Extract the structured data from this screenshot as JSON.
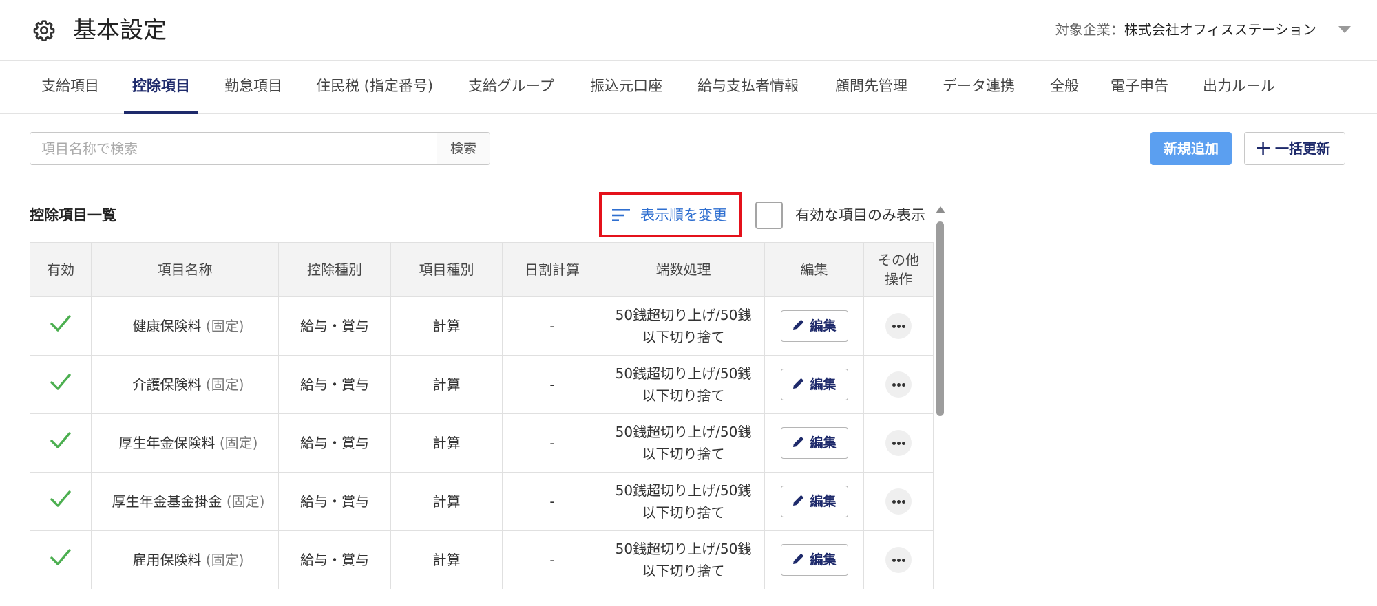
{
  "header": {
    "title": "基本設定",
    "company_label": "対象企業：",
    "company_name": "株式会社オフィスステーション"
  },
  "tabs": [
    {
      "label": "支給項目",
      "active": false
    },
    {
      "label": "控除項目",
      "active": true
    },
    {
      "label": "勤怠項目",
      "active": false
    },
    {
      "label": "住民税 (指定番号)",
      "active": false
    },
    {
      "label": "支給グループ",
      "active": false
    },
    {
      "label": "振込元口座",
      "active": false
    },
    {
      "label": "給与支払者情報",
      "active": false
    },
    {
      "label": "顧問先管理",
      "active": false
    },
    {
      "label": "データ連携",
      "active": false
    },
    {
      "label": "全般",
      "active": false
    },
    {
      "label": "電子申告",
      "active": false
    },
    {
      "label": "出力ルール",
      "active": false
    }
  ],
  "toolbar": {
    "search_placeholder": "項目名称で検索",
    "search_button": "検索",
    "new_button": "新規追加",
    "bulk_update_button": "一括更新"
  },
  "list": {
    "title": "控除項目一覧",
    "sort_link": "表示順を変更",
    "active_only_label": "有効な項目のみ表示",
    "active_only_checked": false
  },
  "table": {
    "headers": [
      "有効",
      "項目名称",
      "控除種別",
      "項目種別",
      "日割計算",
      "端数処理",
      "編集",
      "その他 操作"
    ],
    "edit_label": "編集",
    "rows": [
      {
        "name": "健康保険料",
        "fixed": " (固定)",
        "deduction_type": "給与・賞与",
        "item_type": "計算",
        "proration": "-",
        "rounding_1": "50銭超切り上げ/50銭",
        "rounding_2": "以下切り捨て"
      },
      {
        "name": "介護保険料",
        "fixed": " (固定)",
        "deduction_type": "給与・賞与",
        "item_type": "計算",
        "proration": "-",
        "rounding_1": "50銭超切り上げ/50銭",
        "rounding_2": "以下切り捨て"
      },
      {
        "name": "厚生年金保険料",
        "fixed": " (固定)",
        "deduction_type": "給与・賞与",
        "item_type": "計算",
        "proration": "-",
        "rounding_1": "50銭超切り上げ/50銭",
        "rounding_2": "以下切り捨て"
      },
      {
        "name": "厚生年金基金掛金",
        "fixed": " (固定)",
        "deduction_type": "給与・賞与",
        "item_type": "計算",
        "proration": "-",
        "rounding_1": "50銭超切り上げ/50銭",
        "rounding_2": "以下切り捨て"
      },
      {
        "name": "雇用保険料",
        "fixed": " (固定)",
        "deduction_type": "給与・賞与",
        "item_type": "計算",
        "proration": "-",
        "rounding_1": "50銭超切り上げ/50銭",
        "rounding_2": "以下切り捨て"
      }
    ]
  },
  "colors": {
    "primary": "#1e2a6b",
    "accent_button": "#5b9ff0",
    "link": "#2f6fd0",
    "check": "#4caf50",
    "highlight": "#e4111b"
  }
}
